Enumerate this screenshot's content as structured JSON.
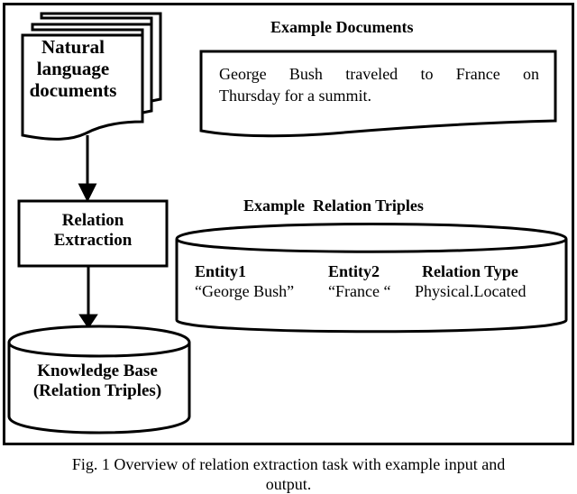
{
  "diagram": {
    "flow": {
      "input_docs_label": [
        "Natural",
        "language",
        "documents"
      ],
      "process_label": [
        "Relation",
        "Extraction"
      ],
      "output_label": [
        "Knowledge Base",
        "(Relation Triples)"
      ]
    },
    "example_documents": {
      "title": "Example Documents",
      "text_line1": "George Bush traveled to France on",
      "text_line2": "Thursday for a summit."
    },
    "example_triples": {
      "title": "Example  Relation Triples",
      "columns": [
        {
          "header": "Entity1",
          "value": "“George Bush”"
        },
        {
          "header": "Entity2",
          "value": "“France “"
        },
        {
          "header": "Relation Type",
          "value": "Physical.Located"
        }
      ]
    },
    "caption": {
      "line1": "Fig. 1 Overview of relation extraction task with example input and",
      "line2": "output."
    }
  }
}
